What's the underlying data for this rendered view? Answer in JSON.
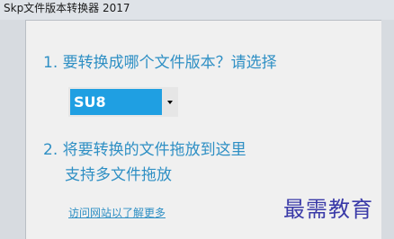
{
  "window": {
    "title": "Skp文件版本转换器 2017"
  },
  "main": {
    "step1_text": "1. 要转换成哪个文件版本？请选择",
    "version_select": {
      "selected": "SU8"
    },
    "step2_line1": "2. 将要转换的文件拖放到这里",
    "step2_line2": "支持多文件拖放",
    "link_text": "访问网站以了解更多"
  },
  "watermark": "最需教育",
  "colors": {
    "accent": "#2e8fc4",
    "selection": "#1f9fe2",
    "background": "#f0f0f0",
    "watermark": "#3a3aa8"
  },
  "icons": {
    "dropdown": "chevron-down-icon"
  }
}
